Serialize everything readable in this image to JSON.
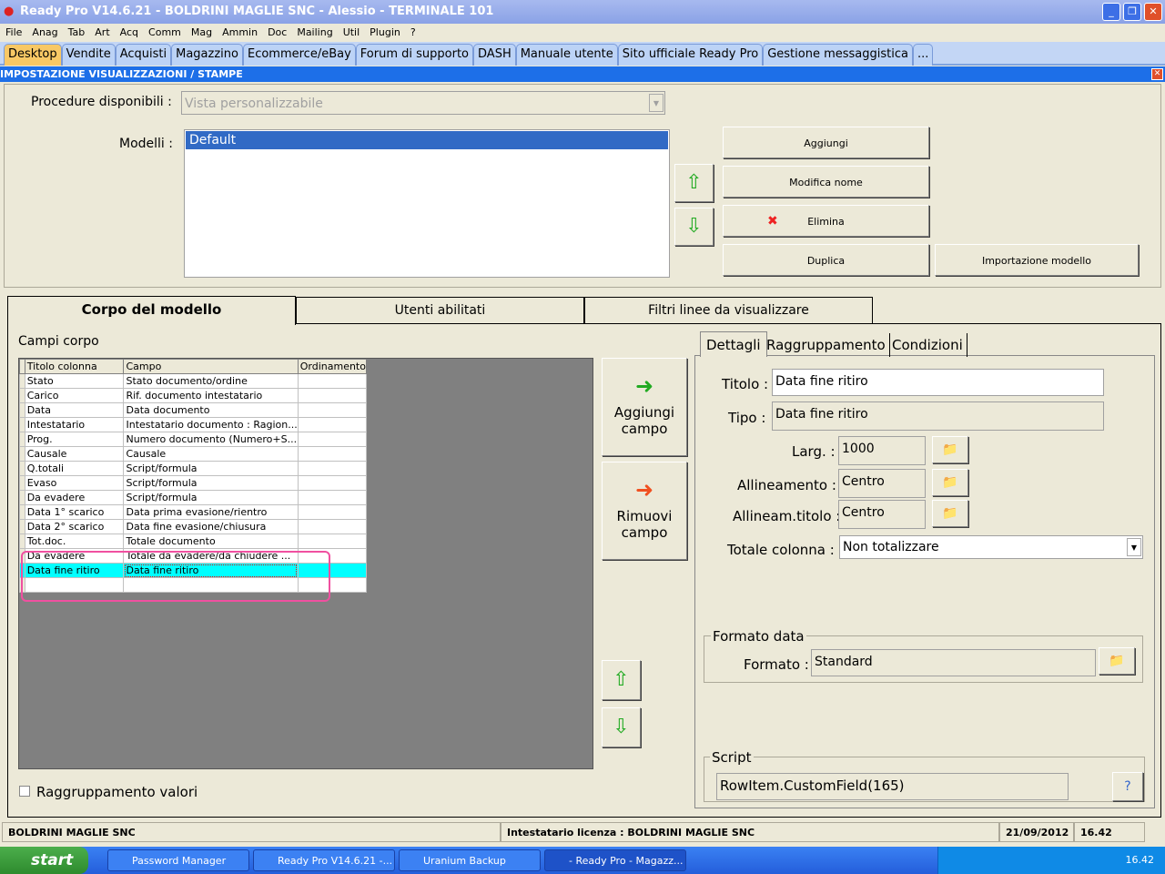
{
  "window": {
    "title": "Ready Pro V14.6.21 - BOLDRINI MAGLIE SNC - Alessio - TERMINALE 101"
  },
  "menu": [
    "File",
    "Anag",
    "Tab",
    "Art",
    "Acq",
    "Comm",
    "Mag",
    "Ammin",
    "Doc",
    "Mailing",
    "Util",
    "Plugin",
    "?"
  ],
  "tabs": [
    "Desktop",
    "Vendite",
    "Acquisti",
    "Magazzino",
    "Ecommerce/eBay",
    "Forum di supporto",
    "DASH",
    "Manuale utente",
    "Sito ufficiale Ready Pro",
    "Gestione messaggistica",
    "..."
  ],
  "panel_title": "IMPOSTAZIONE VISUALIZZAZIONI / STAMPE",
  "procedure": {
    "label": "Procedure disponibili :",
    "value": "Vista personalizzabile"
  },
  "modelli": {
    "label": "Modelli :",
    "items": [
      "Default"
    ]
  },
  "model_buttons": {
    "add": "Aggiungi",
    "rename": "Modifica nome",
    "delete": "Elimina",
    "duplicate": "Duplica",
    "import": "Importazione modello"
  },
  "main_tabs": [
    "Corpo del modello",
    "Utenti abilitati",
    "Filtri linee da visualizzare"
  ],
  "campi": {
    "label": "Campi corpo",
    "headers": [
      "Titolo colonna",
      "Campo",
      "Ordinamento"
    ],
    "rows": [
      [
        "Stato",
        "Stato documento/ordine",
        ""
      ],
      [
        "Carico",
        "Rif. documento intestatario",
        ""
      ],
      [
        "Data",
        "Data documento",
        ""
      ],
      [
        "Intestatario",
        "Intestatario documento : Ragion...",
        ""
      ],
      [
        "Prog.",
        "Numero documento (Numero+S...",
        ""
      ],
      [
        "Causale",
        "Causale",
        ""
      ],
      [
        "Q.totali",
        "Script/formula",
        ""
      ],
      [
        "Evaso",
        "Script/formula",
        ""
      ],
      [
        "Da evadere",
        "Script/formula",
        ""
      ],
      [
        "Data 1° scarico",
        "Data prima evasione/rientro",
        ""
      ],
      [
        "Data 2° scarico",
        "Data fine evasione/chiusura",
        ""
      ],
      [
        "Tot.doc.",
        "Totale documento",
        ""
      ],
      [
        "Da evadere",
        "Totale da evadere/da chiudere ...",
        ""
      ],
      [
        "Data fine ritiro",
        "Data fine ritiro",
        ""
      ],
      [
        "",
        "",
        ""
      ]
    ]
  },
  "field_buttons": {
    "add": "Aggiungi campo",
    "remove": "Rimuovi campo"
  },
  "raggruppamento": "Raggruppamento valori",
  "detail_tabs": [
    "Dettagli",
    "Raggruppamento",
    "Condizioni"
  ],
  "details": {
    "titolo_label": "Titolo :",
    "titolo": "Data fine ritiro",
    "tipo_label": "Tipo :",
    "tipo": "Data fine ritiro",
    "larg_label": "Larg. :",
    "larg": "1000",
    "allin_label": "Allineamento :",
    "allin": "Centro",
    "allint_label": "Allineam.titolo :",
    "allint": "Centro",
    "totale_label": "Totale colonna :",
    "totale": "Non totalizzare"
  },
  "formato": {
    "group": "Formato data",
    "label": "Formato :",
    "value": "Standard"
  },
  "script": {
    "group": "Script",
    "value": "RowItem.CustomField(165)"
  },
  "status": {
    "company": "BOLDRINI MAGLIE SNC",
    "license": "Intestatario licenza : BOLDRINI MAGLIE SNC",
    "date": "21/09/2012",
    "time": "16.42"
  },
  "taskbar": {
    "start": "start",
    "tasks": [
      "Password Manager",
      "Ready Pro V14.6.21 -...",
      "Uranium Backup",
      "- Ready Pro - Magazz..."
    ],
    "clock": "16.42"
  }
}
